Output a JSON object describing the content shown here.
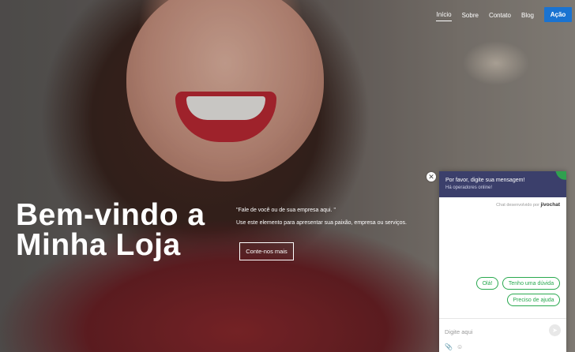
{
  "nav": {
    "links": [
      {
        "label": "Início",
        "active": true
      },
      {
        "label": "Sobre",
        "active": false
      },
      {
        "label": "Contato",
        "active": false
      },
      {
        "label": "Blog",
        "active": false
      }
    ],
    "action_label": "Ação",
    "action_color": "#1a73d1"
  },
  "hero": {
    "title_line1": "Bem-vindo a",
    "title_line2": "Minha Loja",
    "quote": "\"Fale de você ou de sua empresa aqui. \"",
    "description": "Use este elemento para apresentar sua paixão, empresa ou serviços.",
    "cta_label": "Conte-nos mais"
  },
  "chat": {
    "close_icon": "close-icon",
    "header_title": "Por favor, digite sua mensagem!",
    "header_subtitle": "Há operadores online!",
    "header_color": "#3b3f6b",
    "powered_by_text": "Chat desenvolvido por",
    "brand": "jivochat",
    "quick_replies": [
      "Olá!",
      "Tenho uma dúvida",
      "Preciso de ajuda"
    ],
    "quick_reply_color": "#29a94f",
    "input_placeholder": "Digite aqui",
    "send_icon": "send-icon",
    "attach_icon": "paperclip-icon",
    "emoji_icon": "smile-icon"
  }
}
